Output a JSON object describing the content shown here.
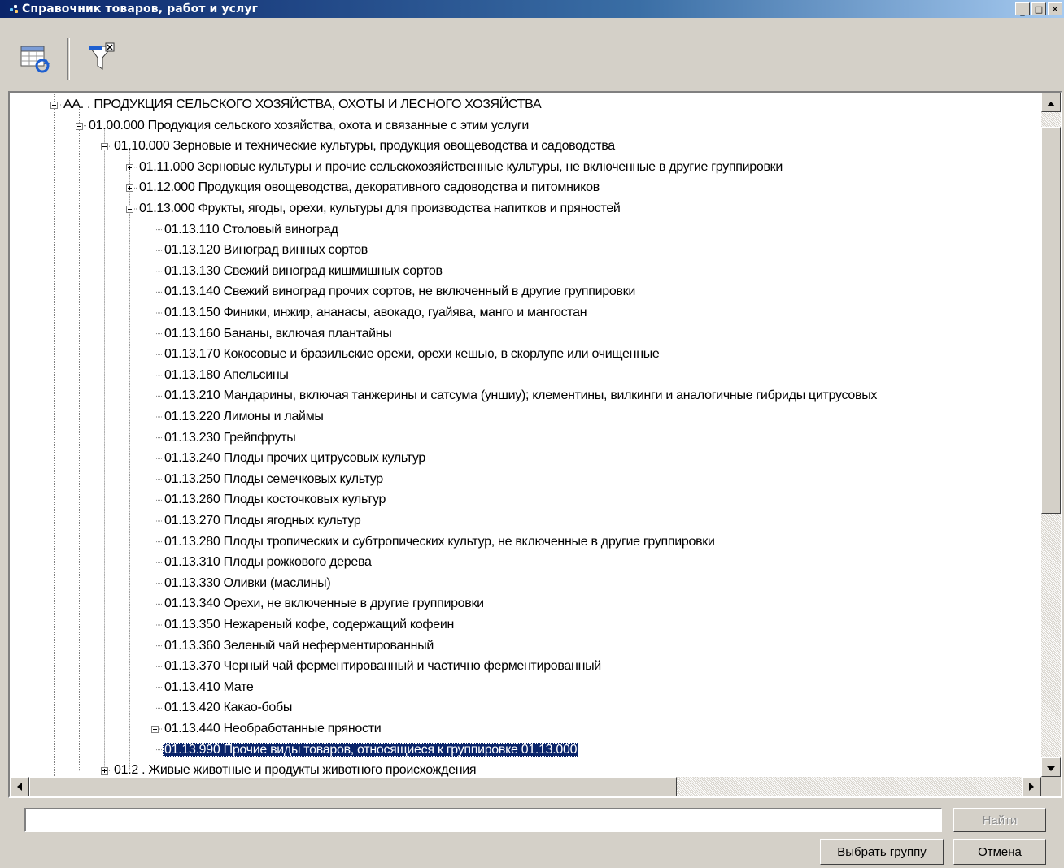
{
  "window": {
    "title": "Справочник товаров, работ и услуг",
    "minimize": "_",
    "maximize": "□",
    "close": "✕"
  },
  "toolbar": {
    "buttons": [
      {
        "icon": "refresh-table-icon"
      },
      {
        "icon": "clear-filter-icon"
      }
    ]
  },
  "tree": {
    "items": [
      {
        "label": "АА.  .    ПРОДУКЦИЯ СЕЛЬСКОГО ХОЗЯЙСТВА, ОХОТЫ И ЛЕСНОГО ХОЗЯЙСТВА",
        "level": 0,
        "state": "expanded"
      },
      {
        "label": "01.00.000 Продукция сельского хозяйства, охота и связанные с этим услуги",
        "level": 1,
        "state": "expanded"
      },
      {
        "label": "01.10.000 Зерновые и технические культуры, продукция овощеводства и садоводства",
        "level": 2,
        "state": "expanded"
      },
      {
        "label": "01.11.000 Зерновые культуры и прочие сельскохозяйственные культуры, не включенные в другие группировки",
        "level": 3,
        "state": "collapsed"
      },
      {
        "label": "01.12.000 Продукция овощеводства, декоративного садоводства и питомников",
        "level": 3,
        "state": "collapsed"
      },
      {
        "label": "01.13.000 Фрукты, ягоды, орехи, культуры для производства напитков и пряностей",
        "level": 3,
        "state": "expanded"
      },
      {
        "label": "01.13.110 Столовый виноград",
        "level": 4,
        "state": "leaf"
      },
      {
        "label": "01.13.120 Виноград винных сортов",
        "level": 4,
        "state": "leaf"
      },
      {
        "label": "01.13.130 Свежий виноград кишмишных сортов",
        "level": 4,
        "state": "leaf"
      },
      {
        "label": "01.13.140 Свежий виноград прочих сортов, не включенный в другие группировки",
        "level": 4,
        "state": "leaf"
      },
      {
        "label": "01.13.150 Финики, инжир, ананасы, авокадо, гуайява, манго и мангостан",
        "level": 4,
        "state": "leaf"
      },
      {
        "label": "01.13.160 Бананы, включая плантайны",
        "level": 4,
        "state": "leaf"
      },
      {
        "label": "01.13.170 Кокосовые и бразильские орехи, орехи кешью, в скорлупе или очищенные",
        "level": 4,
        "state": "leaf"
      },
      {
        "label": "01.13.180 Апельсины",
        "level": 4,
        "state": "leaf"
      },
      {
        "label": "01.13.210 Мандарины, включая танжерины и сатсума (уншиу); клементины, вилкинги и аналогичные гибриды цитрусовых",
        "level": 4,
        "state": "leaf"
      },
      {
        "label": "01.13.220 Лимоны и лаймы",
        "level": 4,
        "state": "leaf"
      },
      {
        "label": "01.13.230 Грейпфруты",
        "level": 4,
        "state": "leaf"
      },
      {
        "label": "01.13.240 Плоды прочих цитрусовых культур",
        "level": 4,
        "state": "leaf"
      },
      {
        "label": "01.13.250 Плоды семечковых культур",
        "level": 4,
        "state": "leaf"
      },
      {
        "label": "01.13.260 Плоды косточковых культур",
        "level": 4,
        "state": "leaf"
      },
      {
        "label": "01.13.270 Плоды ягодных культур",
        "level": 4,
        "state": "leaf"
      },
      {
        "label": "01.13.280 Плоды тропических и субтропических культур, не включенные в другие группировки",
        "level": 4,
        "state": "leaf"
      },
      {
        "label": "01.13.310 Плоды рожкового дерева",
        "level": 4,
        "state": "leaf"
      },
      {
        "label": "01.13.330 Оливки (маслины)",
        "level": 4,
        "state": "leaf"
      },
      {
        "label": "01.13.340 Орехи, не включенные в другие группировки",
        "level": 4,
        "state": "leaf"
      },
      {
        "label": "01.13.350 Нежареный кофе, содержащий кофеин",
        "level": 4,
        "state": "leaf"
      },
      {
        "label": "01.13.360 Зеленый чай неферментированный",
        "level": 4,
        "state": "leaf"
      },
      {
        "label": "01.13.370 Черный чай ферментированный и частично ферментированный",
        "level": 4,
        "state": "leaf"
      },
      {
        "label": "01.13.410 Мате",
        "level": 4,
        "state": "leaf"
      },
      {
        "label": "01.13.420 Какао-бобы",
        "level": 4,
        "state": "leaf"
      },
      {
        "label": "01.13.440 Необработанные пряности",
        "level": 4,
        "state": "collapsed"
      },
      {
        "label": "01.13.990 Прочие виды товаров, относящиеся к группировке 01.13.000",
        "level": 4,
        "state": "leaf",
        "selected": true
      },
      {
        "label": "01.2 .    Живые животные и продукты животного происхождения",
        "level": 3,
        "state": "collapsed",
        "indent_override": 2
      }
    ]
  },
  "search": {
    "value": "",
    "placeholder": ""
  },
  "buttons": {
    "find": "Найти",
    "select_group": "Выбрать группу",
    "cancel": "Отмена"
  },
  "colors": {
    "titlebar": "#0a246a",
    "selection": "#0a246a",
    "face": "#d4d0c8"
  }
}
